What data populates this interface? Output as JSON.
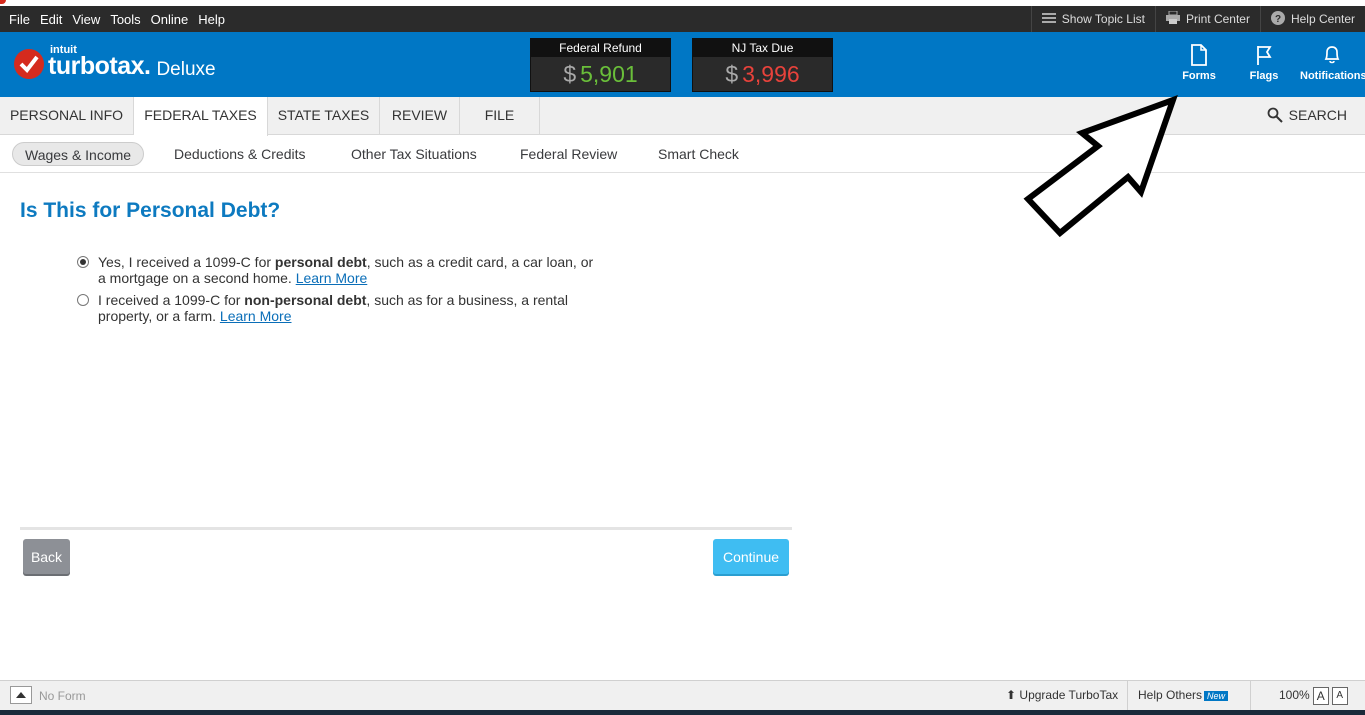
{
  "menubar": {
    "items": [
      "File",
      "Edit",
      "View",
      "Tools",
      "Online",
      "Help"
    ],
    "show_topic_list": "Show Topic List",
    "print_center": "Print Center",
    "help_center": "Help Center"
  },
  "header": {
    "brand_intuit": "intuit",
    "brand_name": "turbotax.",
    "edition": "Deluxe",
    "federal_refund_label": "Federal Refund",
    "federal_refund_currency": "$",
    "federal_refund_amount": "5,901",
    "nj_tax_label": "NJ Tax Due",
    "nj_tax_currency": "$",
    "nj_tax_amount": "3,996",
    "forms_label": "Forms",
    "flags_label": "Flags",
    "notifications_label": "Notifications",
    "refund_color": "#6abf3a",
    "due_color": "#e8423b"
  },
  "tabs": {
    "items": [
      "PERSONAL INFO",
      "FEDERAL TAXES",
      "STATE TAXES",
      "REVIEW",
      "FILE"
    ],
    "active": "FEDERAL TAXES",
    "search": "SEARCH"
  },
  "subnav": {
    "items": [
      "Wages & Income",
      "Deductions & Credits",
      "Other Tax Situations",
      "Federal Review",
      "Smart Check"
    ],
    "active": "Wages & Income"
  },
  "main": {
    "title": "Is This for Personal Debt?",
    "option1_pre": "Yes, I received a 1099-C for ",
    "option1_bold": "personal debt",
    "option1_post": ", such as a credit card, a car loan, or a mortgage on a second home.",
    "option1_link": "Learn More",
    "option1_selected": true,
    "option2_pre": "I received a 1099-C for ",
    "option2_bold": "non-personal debt",
    "option2_post": ", such as for a business, a rental property, or a farm.",
    "option2_link": "Learn More",
    "option2_selected": false,
    "back_label": "Back",
    "continue_label": "Continue"
  },
  "statusbar": {
    "no_form": "No Form",
    "upgrade": "Upgrade TurboTax",
    "help_others": "Help Others",
    "new_badge": "New",
    "zoom": "100%",
    "font_larger": "A",
    "font_smaller": "A"
  }
}
